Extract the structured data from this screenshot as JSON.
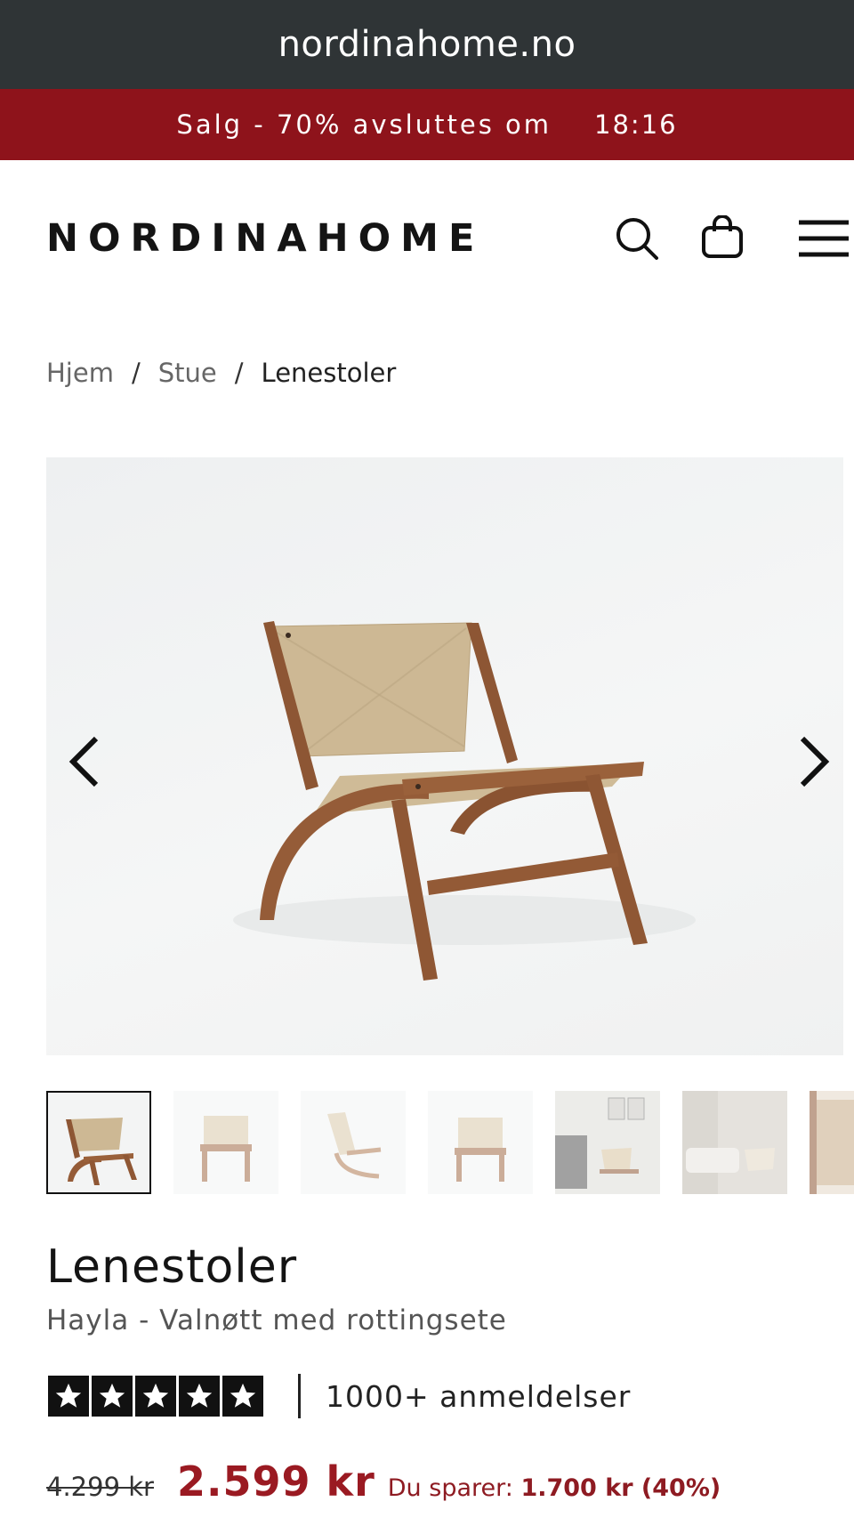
{
  "browser": {
    "url": "nordinahome.no"
  },
  "promo": {
    "text": "Salg - 70% avsluttes om",
    "timer": "18:16"
  },
  "header": {
    "logo": "NORDINAHOME",
    "icons": [
      "search-icon",
      "shopping-bag-icon",
      "hamburger-menu-icon"
    ]
  },
  "breadcrumb": {
    "items": [
      "Hjem",
      "Stue",
      "Lenestoler"
    ],
    "separator": "/"
  },
  "gallery": {
    "prev_icon": "chevron-left-icon",
    "next_icon": "chevron-right-icon",
    "thumbnail_count": 7,
    "active_index": 0
  },
  "product": {
    "category": "Lenestoler",
    "name": "Hayla - Valnøtt med rottingsete",
    "rating_stars": 5,
    "reviews": "1000+ anmeldelser",
    "old_price": "4.299 kr",
    "new_price": "2.599 kr",
    "savings_label": "Du sparer:",
    "savings_value": "1.700 kr (40%)"
  },
  "colors": {
    "urlbar": "#2f3436",
    "promo": "#8e131b",
    "price": "#9a1a22"
  }
}
